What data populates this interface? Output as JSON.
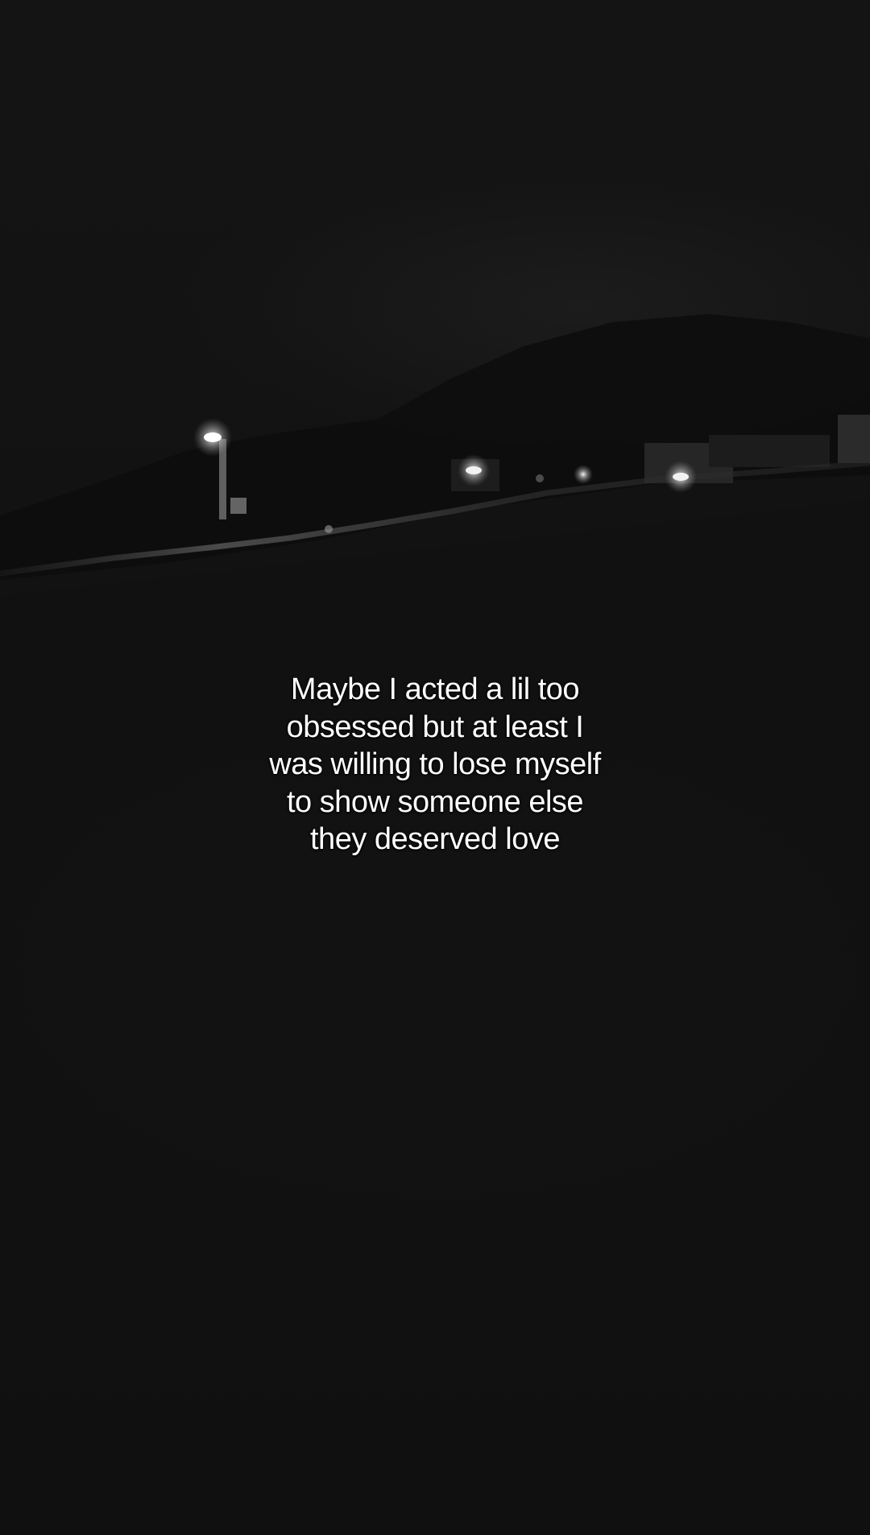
{
  "caption": {
    "lines": [
      "Maybe I acted a lil too",
      "obsessed but at least I",
      "was willing to lose myself",
      "to show someone else",
      "they deserved love"
    ]
  }
}
